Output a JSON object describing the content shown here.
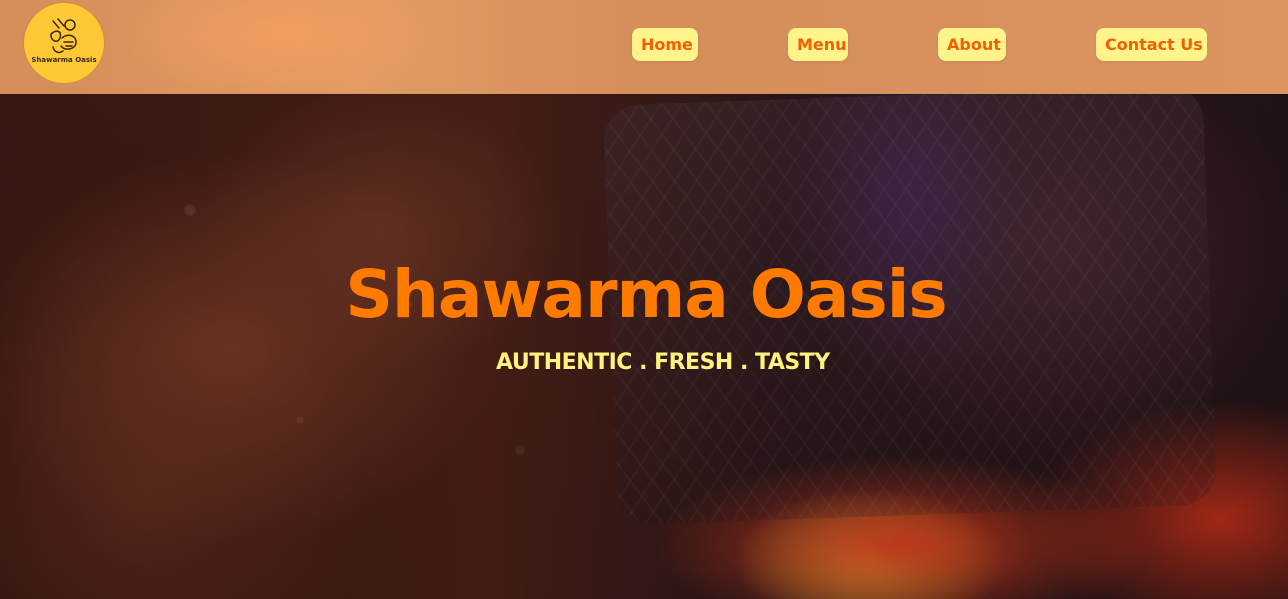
{
  "colors": {
    "header_background": "#dc9560",
    "logo_background": "#ffc936",
    "nav_button_background": "#fff48b",
    "nav_text": "#f26000",
    "hero_title": "#ff7b00",
    "hero_tagline": "#fff27d"
  },
  "header": {
    "logo": {
      "icon_name": "shawarma-ingredients-icon",
      "text": "Shawarma Oasis"
    },
    "nav": [
      {
        "label": "Home"
      },
      {
        "label": "Menu"
      },
      {
        "label": "About"
      },
      {
        "label": "Contact Us"
      }
    ]
  },
  "hero": {
    "background_description_icon": "blurred-shawarma-grill",
    "title": "Shawarma Oasis",
    "tagline": "AUTHENTIC . FRESH . TASTY"
  }
}
